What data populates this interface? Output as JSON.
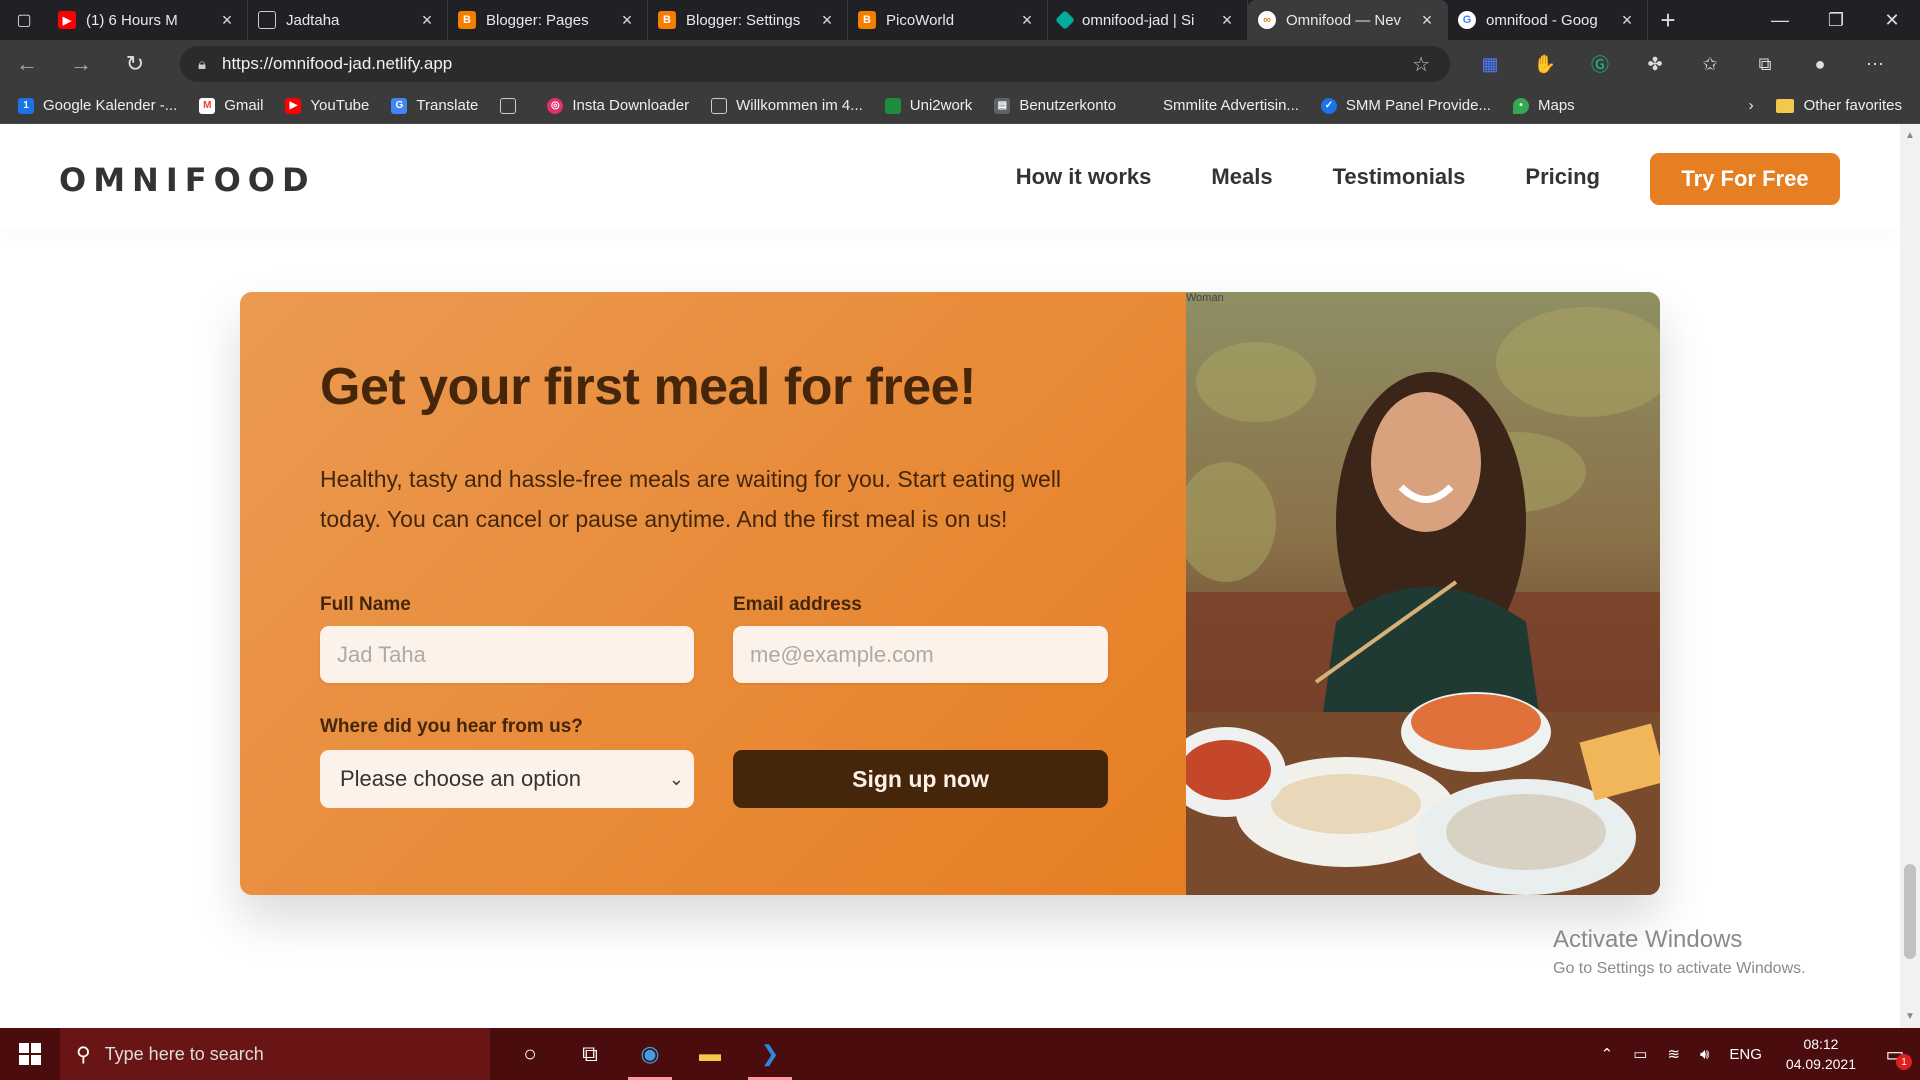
{
  "browser": {
    "tabs": [
      {
        "title": "(1) 6 Hours M",
        "favicon": "youtube-icon",
        "color": "#ff0000"
      },
      {
        "title": "Jadtaha",
        "favicon": "page-icon",
        "color": "#666666"
      },
      {
        "title": "Blogger: Pages",
        "favicon": "blogger-icon",
        "color": "#f57d00"
      },
      {
        "title": "Blogger: Settings",
        "favicon": "blogger-icon",
        "color": "#f57d00"
      },
      {
        "title": "PicoWorld",
        "favicon": "blogger-icon",
        "color": "#f57d00"
      },
      {
        "title": "omnifood-jad | Si",
        "favicon": "netlify-icon",
        "color": "#00ad9f"
      },
      {
        "title": "Omnifood — Nev",
        "favicon": "omnifood-icon",
        "color": "#e67e22",
        "active": true
      },
      {
        "title": "omnifood - Goog",
        "favicon": "google-icon",
        "color": "#4285f4"
      }
    ],
    "url": "https://omnifood-jad.netlify.app",
    "bookmarks": [
      {
        "label": "Google Kalender -...",
        "icon": "calendar-icon",
        "color": "#1a73e8"
      },
      {
        "label": "Gmail",
        "icon": "gmail-icon",
        "color": "#ea4335"
      },
      {
        "label": "YouTube",
        "icon": "youtube-icon",
        "color": "#ff0000"
      },
      {
        "label": "Translate",
        "icon": "translate-icon",
        "color": "#4285f4"
      },
      {
        "label": "",
        "icon": "page-icon",
        "color": "#888888"
      },
      {
        "label": "Insta Downloader",
        "icon": "instagram-icon",
        "color": "#e1306c"
      },
      {
        "label": "Willkommen im 4...",
        "icon": "page-icon",
        "color": "#888888"
      },
      {
        "label": "Uni2work",
        "icon": "uni2work-icon",
        "color": "#1e8e3e"
      },
      {
        "label": "Benutzerkonto",
        "icon": "account-icon",
        "color": "#5f6368"
      },
      {
        "label": "Smmlite Advertisin...",
        "icon": "page-icon",
        "color": "#3b3b3b"
      },
      {
        "label": "SMM Panel Provide...",
        "icon": "check-badge-icon",
        "color": "#1a73e8"
      },
      {
        "label": "Maps",
        "icon": "maps-icon",
        "color": "#34a853"
      }
    ],
    "other_favorites": "Other favorites"
  },
  "site": {
    "logo": "OMNIFOOD",
    "nav": [
      "How it works",
      "Meals",
      "Testimonials",
      "Pricing"
    ],
    "cta_button": "Try For Free"
  },
  "cta": {
    "title": "Get your first meal for free!",
    "text": "Healthy, tasty and hassle-free meals are waiting for you. Start eating well today. You can cancel or pause anytime. And the first meal is on us!",
    "form": {
      "name_label": "Full Name",
      "name_placeholder": "Jad Taha",
      "email_label": "Email address",
      "email_placeholder": "me@example.com",
      "source_label": "Where did you hear from us?",
      "source_selected": "Please choose an option",
      "submit": "Sign up now"
    },
    "image_caption": "Woman"
  },
  "os": {
    "activate_title": "Activate Windows",
    "activate_subtitle": "Go to Settings to activate Windows.",
    "search_placeholder": "Type here to search",
    "language": "ENG",
    "time": "08:12",
    "date": "04.09.2021",
    "notification_count": "1"
  },
  "colors": {
    "brand": "#e67e22",
    "brand_dark": "#45260a",
    "brand_tint": "#fdf2e9"
  }
}
